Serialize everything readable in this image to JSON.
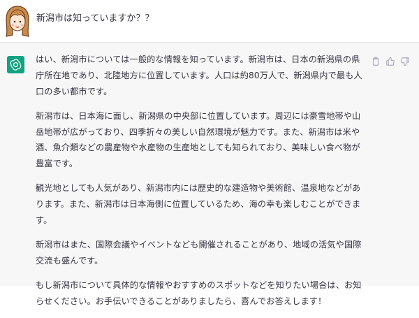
{
  "user": {
    "avatar_icon": "user-avatar",
    "message": "新潟市は知っていますか？？"
  },
  "assistant": {
    "logo_icon": "openai-logo",
    "paragraphs": [
      "はい、新潟市については一般的な情報を知っています。新潟市は、日本の新潟県の県庁所在地であり、北陸地方に位置しています。人口は約80万人で、新潟県内で最も人口の多い都市です。",
      "新潟市は、日本海に面し、新潟県の中央部に位置しています。周辺には豪雪地帯や山岳地帯が広がっており、四季折々の美しい自然環境が魅力です。また、新潟市は米や酒、魚介類などの農産物や水産物の生産地としても知られており、美味しい食べ物が豊富です。",
      "観光地としても人気があり、新潟市内には歴史的な建造物や美術館、温泉地などがあります。また、新潟市は日本海側に位置しているため、海の幸も楽しむことができます。",
      "新潟市はまた、国際会議やイベントなども開催されることがあり、地域の活気や国際交流も盛んです。",
      "もし新潟市について具体的な情報やおすすめのスポットなどを知りたい場合は、お知らせください。お手伝いできることがありましたら、喜んでお答えします！"
    ],
    "tools": {
      "copy_icon": "copy-icon",
      "thumbs_up_icon": "thumbs-up-icon",
      "thumbs_down_icon": "thumbs-down-icon"
    }
  },
  "colors": {
    "user_bg": "#ffffff",
    "assistant_bg": "#f7f7f8",
    "text": "#343541",
    "logo": "#10a37f",
    "tool_icon": "#acacbe"
  }
}
